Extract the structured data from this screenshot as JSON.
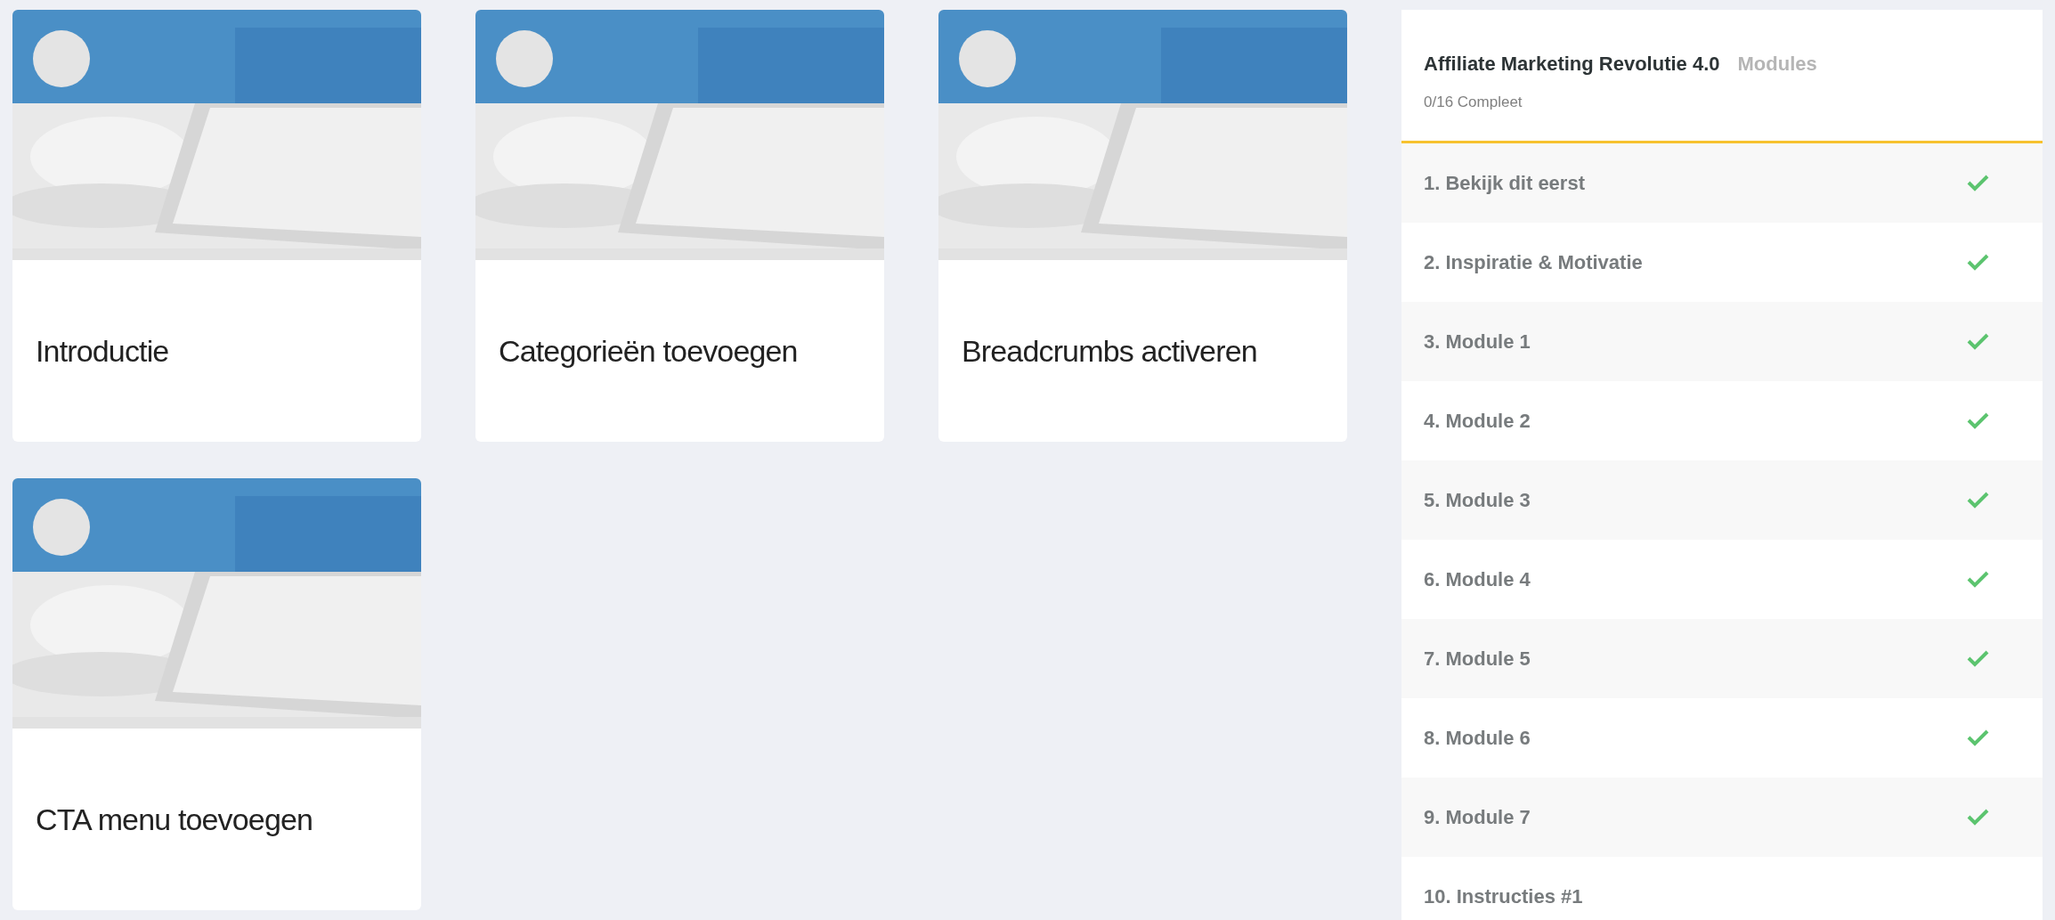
{
  "videos": [
    {
      "title": "Introductie"
    },
    {
      "title": "Categorieën toevoegen"
    },
    {
      "title": "Breadcrumbs activeren"
    },
    {
      "title": "CTA menu toevoegen"
    }
  ],
  "sidebar": {
    "course_title": "Affiliate Marketing Revolutie 4.0",
    "section_label": "Modules",
    "progress": "0/16 Compleet",
    "items": [
      {
        "label": "1. Bekijk dit eerst",
        "done": true
      },
      {
        "label": "2. Inspiratie & Motivatie",
        "done": true
      },
      {
        "label": "3. Module 1",
        "done": true
      },
      {
        "label": "4. Module 2",
        "done": true
      },
      {
        "label": "5. Module 3",
        "done": true
      },
      {
        "label": "6. Module 4",
        "done": true
      },
      {
        "label": "7. Module 5",
        "done": true
      },
      {
        "label": "8. Module 6",
        "done": true
      },
      {
        "label": "9. Module 7",
        "done": true
      },
      {
        "label": "10. Instructies #1",
        "done": false
      }
    ]
  }
}
